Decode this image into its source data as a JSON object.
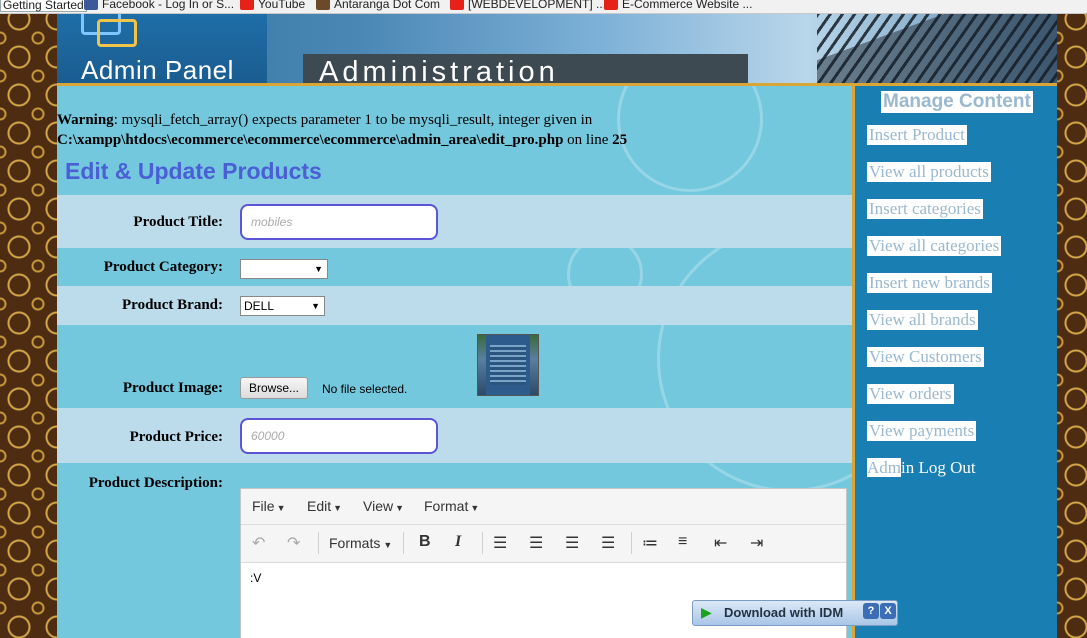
{
  "bookmarks": [
    {
      "label": "Getting Started",
      "icon": "none"
    },
    {
      "label": "Facebook - Log In or S...",
      "icon": "facebook-icon"
    },
    {
      "label": "YouTube",
      "icon": "youtube-icon"
    },
    {
      "label": "Antaranga Dot Com",
      "icon": "site-icon"
    },
    {
      "label": "[WEBDEVELOPMENT] ...",
      "icon": "youtube-icon"
    },
    {
      "label": "E-Commerce Website ...",
      "icon": "youtube-icon"
    }
  ],
  "header": {
    "logo_text": "Admin Panel",
    "banner_text": "Administration"
  },
  "warning": {
    "label": "Warning",
    "message": ": mysqli_fetch_array() expects parameter 1 to be mysqli_result, integer given in ",
    "path": "C:\\xampp\\htdocs\\ecommerce\\ecommerce\\ecommerce\\admin_area\\edit_pro.php",
    "on_line": " on line ",
    "line": "25"
  },
  "form": {
    "title": "Edit & Update Products",
    "product_title_label": "Product Title:",
    "product_title_placeholder": "mobiles",
    "category_label": "Product Category:",
    "category_value": "",
    "brand_label": "Product Brand:",
    "brand_value": "DELL",
    "image_label": "Product Image:",
    "browse_label": "Browse...",
    "file_status": "No file selected.",
    "price_label": "Product Price:",
    "price_placeholder": "60000",
    "description_label": "Product Description:"
  },
  "editor": {
    "menus": [
      "File",
      "Edit",
      "View",
      "Format"
    ],
    "formats_label": "Formats",
    "content": ":V"
  },
  "sidebar": {
    "title": "Manage Content",
    "links": [
      "Insert Product",
      "View all products",
      "Insert categories",
      "View all categories",
      "Insert new brands",
      "View all brands",
      "View Customers",
      "View orders",
      "View payments"
    ],
    "logout_highlight": "Adm",
    "logout_rest": "in Log Out"
  },
  "idm": {
    "label": "Download with IDM",
    "help": "?",
    "close": "X"
  }
}
